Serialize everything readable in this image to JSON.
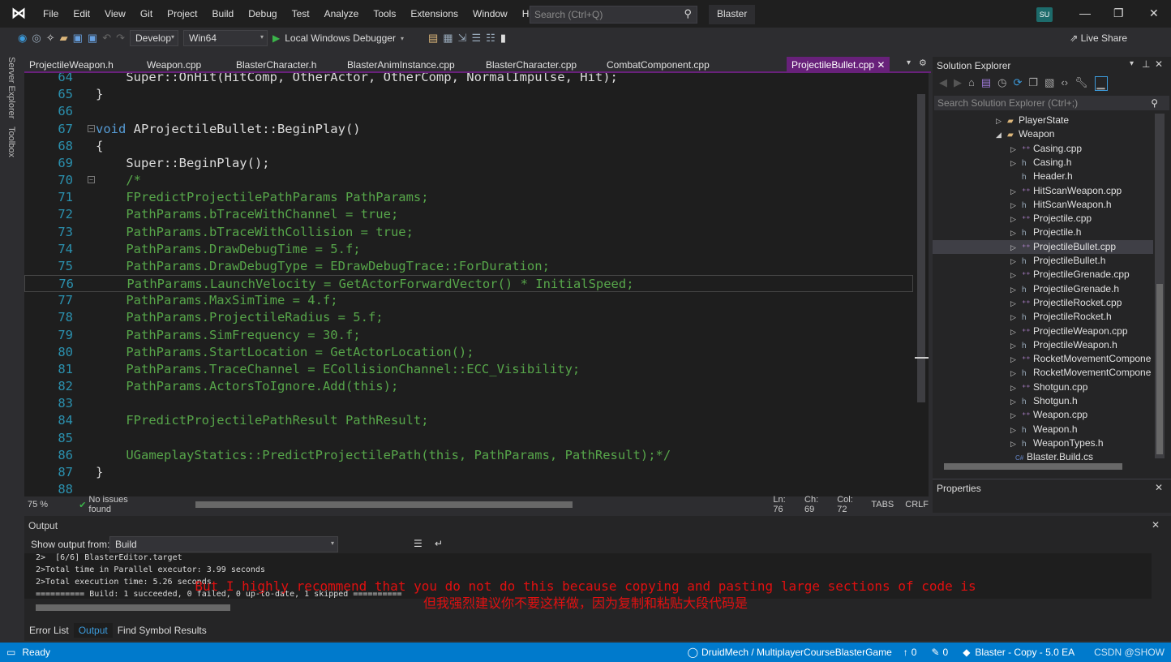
{
  "titlebar": {
    "menus": [
      "File",
      "Edit",
      "View",
      "Git",
      "Project",
      "Build",
      "Debug",
      "Test",
      "Analyze",
      "Tools",
      "Extensions",
      "Window",
      "Help"
    ],
    "search_placeholder": "Search (Ctrl+Q)",
    "app_title": "Blaster",
    "avatar": "SU"
  },
  "toolbar": {
    "config": "Develop",
    "platform": "Win64",
    "debugger": "Local Windows Debugger",
    "live_share": "Live Share"
  },
  "left_strip": [
    "Server Explorer",
    "Toolbox"
  ],
  "tabs": [
    {
      "label": "ProjectileWeapon.h"
    },
    {
      "label": "Weapon.cpp"
    },
    {
      "label": "BlasterCharacter.h"
    },
    {
      "label": "BlasterAnimInstance.cpp"
    },
    {
      "label": "BlasterCharacter.cpp"
    },
    {
      "label": "CombatComponent.cpp"
    },
    {
      "label": "ProjectileBullet.cpp",
      "active": true
    }
  ],
  "code": [
    {
      "n": "64",
      "seg": [
        [
          "tx",
          "    Super::OnHit(HitComp, OtherActor, OtherComp, NormalImpulse, Hit);"
        ]
      ]
    },
    {
      "n": "65",
      "seg": [
        [
          "tx",
          "}"
        ]
      ]
    },
    {
      "n": "66",
      "seg": []
    },
    {
      "n": "67",
      "fold": true,
      "seg": [
        [
          "kw",
          "void"
        ],
        [
          "tx",
          " AProjectileBullet::BeginPlay()"
        ]
      ]
    },
    {
      "n": "68",
      "seg": [
        [
          "tx",
          "{"
        ]
      ]
    },
    {
      "n": "69",
      "seg": [
        [
          "tx",
          "    Super::BeginPlay();"
        ]
      ]
    },
    {
      "n": "70",
      "fold": true,
      "seg": [
        [
          "cm",
          "    /*"
        ]
      ]
    },
    {
      "n": "71",
      "seg": [
        [
          "cm",
          "    FPredictProjectilePathParams PathParams;"
        ]
      ]
    },
    {
      "n": "72",
      "seg": [
        [
          "cm",
          "    PathParams.bTraceWithChannel = true;"
        ]
      ]
    },
    {
      "n": "73",
      "seg": [
        [
          "cm",
          "    PathParams.bTraceWithCollision = true;"
        ]
      ]
    },
    {
      "n": "74",
      "seg": [
        [
          "cm",
          "    PathParams.DrawDebugTime = 5.f;"
        ]
      ]
    },
    {
      "n": "75",
      "seg": [
        [
          "cm",
          "    PathParams.DrawDebugType = EDrawDebugTrace::ForDuration;"
        ]
      ]
    },
    {
      "n": "76",
      "current": true,
      "seg": [
        [
          "cm",
          "    PathParams.LaunchVelocity = GetActorForwardVector() * InitialSpeed;"
        ]
      ]
    },
    {
      "n": "77",
      "seg": [
        [
          "cm",
          "    PathParams.MaxSimTime = 4.f;"
        ]
      ]
    },
    {
      "n": "78",
      "seg": [
        [
          "cm",
          "    PathParams.ProjectileRadius = 5.f;"
        ]
      ]
    },
    {
      "n": "79",
      "seg": [
        [
          "cm",
          "    PathParams.SimFrequency = 30.f;"
        ]
      ]
    },
    {
      "n": "80",
      "seg": [
        [
          "cm",
          "    PathParams.StartLocation = GetActorLocation();"
        ]
      ]
    },
    {
      "n": "81",
      "seg": [
        [
          "cm",
          "    PathParams.TraceChannel = ECollisionChannel::ECC_Visibility;"
        ]
      ]
    },
    {
      "n": "82",
      "seg": [
        [
          "cm",
          "    PathParams.ActorsToIgnore.Add(this);"
        ]
      ]
    },
    {
      "n": "83",
      "seg": []
    },
    {
      "n": "84",
      "seg": [
        [
          "cm",
          "    FPredictProjectilePathResult PathResult;"
        ]
      ]
    },
    {
      "n": "85",
      "seg": []
    },
    {
      "n": "86",
      "seg": [
        [
          "cm",
          "    UGameplayStatics::PredictProjectilePath(this, PathParams, PathResult);*/"
        ]
      ]
    },
    {
      "n": "87",
      "seg": [
        [
          "tx",
          "}"
        ]
      ]
    },
    {
      "n": "88",
      "seg": []
    }
  ],
  "editor_status": {
    "zoom": "75 %",
    "issues": "No issues found",
    "ln": "Ln: 76",
    "ch": "Ch: 69",
    "col": "Col: 72",
    "tabs": "TABS",
    "eol": "CRLF"
  },
  "solution_explorer": {
    "title": "Solution Explorer",
    "search_placeholder": "Search Solution Explorer (Ctrl+;)",
    "items": [
      {
        "label": "PlayerState",
        "kind": "folder",
        "depth": 0,
        "exp": "closed"
      },
      {
        "label": "Weapon",
        "kind": "folder",
        "depth": 0,
        "exp": "open"
      },
      {
        "label": "Casing.cpp",
        "kind": "cpp",
        "depth": 1,
        "exp": "closed"
      },
      {
        "label": "Casing.h",
        "kind": "h",
        "depth": 1,
        "exp": "closed"
      },
      {
        "label": "Header.h",
        "kind": "h",
        "depth": 1,
        "exp": "none"
      },
      {
        "label": "HitScanWeapon.cpp",
        "kind": "cpp",
        "depth": 1,
        "exp": "closed"
      },
      {
        "label": "HitScanWeapon.h",
        "kind": "h",
        "depth": 1,
        "exp": "closed"
      },
      {
        "label": "Projectile.cpp",
        "kind": "cpp",
        "depth": 1,
        "exp": "closed"
      },
      {
        "label": "Projectile.h",
        "kind": "h",
        "depth": 1,
        "exp": "closed"
      },
      {
        "label": "ProjectileBullet.cpp",
        "kind": "cpp",
        "depth": 1,
        "exp": "closed",
        "selected": true
      },
      {
        "label": "ProjectileBullet.h",
        "kind": "h",
        "depth": 1,
        "exp": "closed"
      },
      {
        "label": "ProjectileGrenade.cpp",
        "kind": "cpp",
        "depth": 1,
        "exp": "closed"
      },
      {
        "label": "ProjectileGrenade.h",
        "kind": "h",
        "depth": 1,
        "exp": "closed"
      },
      {
        "label": "ProjectileRocket.cpp",
        "kind": "cpp",
        "depth": 1,
        "exp": "closed"
      },
      {
        "label": "ProjectileRocket.h",
        "kind": "h",
        "depth": 1,
        "exp": "closed"
      },
      {
        "label": "ProjectileWeapon.cpp",
        "kind": "cpp",
        "depth": 1,
        "exp": "closed"
      },
      {
        "label": "ProjectileWeapon.h",
        "kind": "h",
        "depth": 1,
        "exp": "closed"
      },
      {
        "label": "RocketMovementCompone",
        "kind": "cpp",
        "depth": 1,
        "exp": "closed"
      },
      {
        "label": "RocketMovementCompone",
        "kind": "h",
        "depth": 1,
        "exp": "closed"
      },
      {
        "label": "Shotgun.cpp",
        "kind": "cpp",
        "depth": 1,
        "exp": "closed"
      },
      {
        "label": "Shotgun.h",
        "kind": "h",
        "depth": 1,
        "exp": "closed"
      },
      {
        "label": "Weapon.cpp",
        "kind": "cpp",
        "depth": 1,
        "exp": "closed"
      },
      {
        "label": "Weapon.h",
        "kind": "h",
        "depth": 1,
        "exp": "closed"
      },
      {
        "label": "WeaponTypes.h",
        "kind": "h",
        "depth": 1,
        "exp": "closed"
      },
      {
        "label": "Blaster.Build.cs",
        "kind": "cs",
        "depth": -1,
        "exp": "none"
      }
    ]
  },
  "properties": {
    "title": "Properties"
  },
  "output": {
    "title": "Output",
    "show_from_label": "Show output from:",
    "source": "Build",
    "lines": [
      "2>  [6/6] BlasterEditor.target",
      "2>Total time in Parallel executor: 3.99 seconds",
      "2>Total execution time: 5.26 seconds",
      "========== Build: 1 succeeded, 0 failed, 0 up-to-date, 1 skipped =========="
    ],
    "bottom_tabs": [
      {
        "label": "Error List"
      },
      {
        "label": "Output",
        "active": true
      },
      {
        "label": "Find Symbol Results"
      }
    ]
  },
  "subtitles": {
    "en": "But I highly recommend that you do not do this because copying and pasting large sections of code is",
    "zh": "但我强烈建议你不要这样做，因为复制和粘贴大段代码是"
  },
  "statusbar": {
    "ready": "Ready",
    "repo": "DruidMech / MultiplayerCourseBlasterGame",
    "push": "0",
    "changes": "0",
    "branch_project": "Blaster - Copy - 5.0 EA",
    "watermark": "CSDN @SHOW"
  },
  "colors": {
    "accent": "#007acc",
    "active_tab": "#68217a",
    "comment": "#57a64a",
    "keyword": "#569cd6",
    "line_number": "#2b91af"
  }
}
